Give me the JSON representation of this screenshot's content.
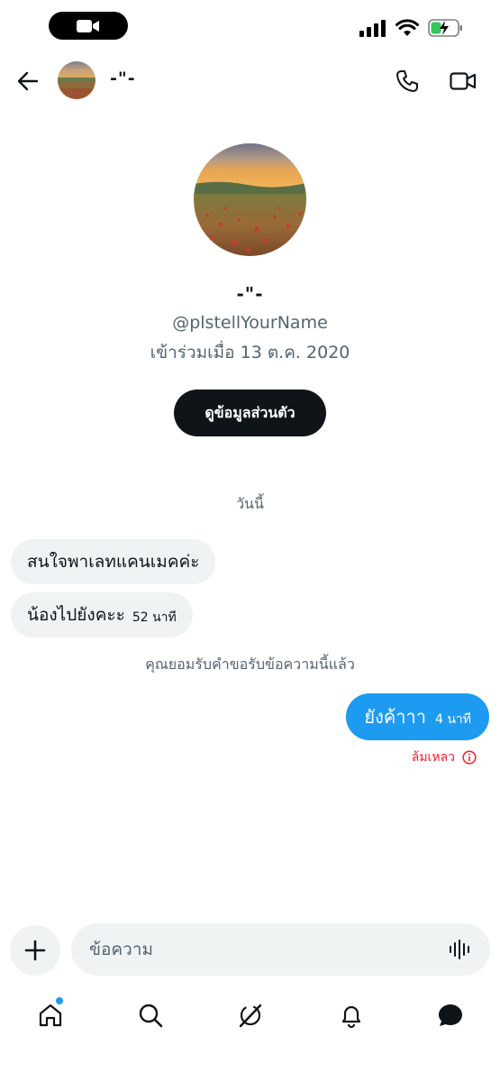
{
  "header": {
    "name": "-\"-"
  },
  "profile": {
    "name": "-\"-",
    "handle": "@plstellYourName",
    "joined": "เข้าร่วมเมื่อ 13 ต.ค. 2020",
    "view_profile_label": "ดูข้อมูลส่วนตัว"
  },
  "conversation": {
    "date_separator": "วันนี้",
    "incoming": [
      {
        "text": "สนใจพาเลทแคนเมคค่ะ",
        "time": ""
      },
      {
        "text": "น้องไปยังคะะ",
        "time": "52 นาที"
      }
    ],
    "accepted_notice": "คุณยอมรับคำขอรับข้อความนี้แล้ว",
    "outgoing": {
      "text": "ยังค้าาา",
      "time": "4 นาที"
    },
    "failed_label": "ล้มเหลว"
  },
  "composer": {
    "placeholder": "ข้อความ"
  },
  "colors": {
    "accent": "#1d9bf0",
    "error": "#f4212e",
    "bubble_in": "#eff3f4",
    "primary_text": "#0f1419",
    "secondary_text": "#536471"
  },
  "icons": {
    "status": [
      "video-camera-icon",
      "signal-icon",
      "wifi-icon",
      "battery-charging-icon"
    ],
    "header": [
      "back-arrow-icon",
      "phone-icon",
      "video-call-icon"
    ],
    "nav": [
      "home-icon",
      "search-icon",
      "grok-icon",
      "bell-icon",
      "messages-icon"
    ]
  }
}
